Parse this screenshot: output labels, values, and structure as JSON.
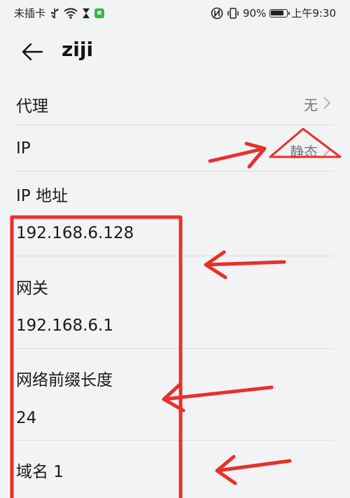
{
  "status_bar": {
    "carrier": "未插卡",
    "battery_percent_label": "90%",
    "battery_level": 0.9,
    "time": "上午9:30",
    "icons": [
      "usb-icon",
      "wifi-icon",
      "hourglass-icon",
      "app-notification-icon",
      "nfc-icon",
      "vibrate-icon",
      "battery-icon"
    ]
  },
  "app_bar": {
    "title": "ziji",
    "back_icon": "arrow-left-icon"
  },
  "settings": {
    "proxy": {
      "label": "代理",
      "value": "无"
    },
    "ip": {
      "label": "IP",
      "value": "静态"
    }
  },
  "fields": {
    "ip_address": {
      "label": "IP 地址",
      "value": "192.168.6.128"
    },
    "gateway": {
      "label": "网关",
      "value": "192.168.6.1"
    },
    "prefix_length": {
      "label": "网络前缀长度",
      "value": "24"
    },
    "dns1": {
      "label": "域名 1"
    }
  },
  "annotation": {
    "color": "#e8302a"
  }
}
